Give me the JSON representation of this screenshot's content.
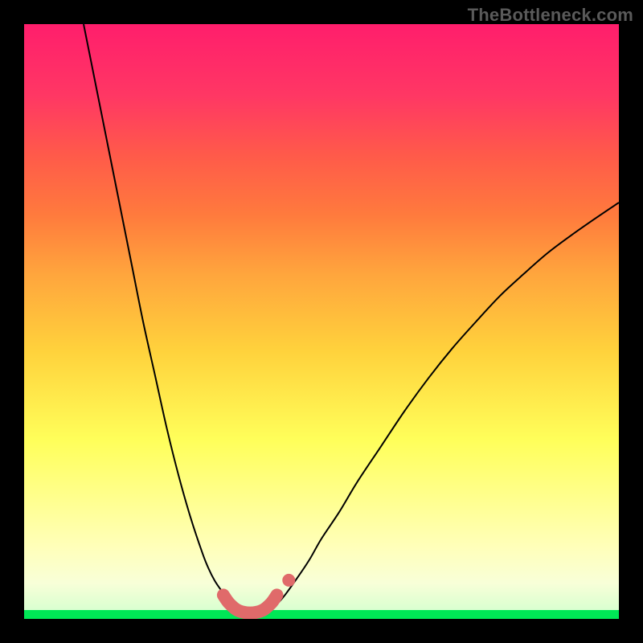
{
  "watermark": "TheBottleneck.com",
  "chart_data": {
    "type": "line",
    "title": "",
    "xlabel": "",
    "ylabel": "",
    "xlim": [
      0,
      100
    ],
    "ylim": [
      0,
      100
    ],
    "background_gradient": {
      "direction": "vertical",
      "stops": [
        {
          "pos": 0,
          "color": "#00e756",
          "meaning": "optimal / no bottleneck"
        },
        {
          "pos": 2,
          "color": "#d9ffd0"
        },
        {
          "pos": 6,
          "color": "#f8ffd8"
        },
        {
          "pos": 12,
          "color": "#ffffba"
        },
        {
          "pos": 30,
          "color": "#ffff5a"
        },
        {
          "pos": 45,
          "color": "#ffd23c"
        },
        {
          "pos": 58,
          "color": "#ffa53d"
        },
        {
          "pos": 68,
          "color": "#ff7a3d"
        },
        {
          "pos": 78,
          "color": "#ff5a4a"
        },
        {
          "pos": 88,
          "color": "#ff3764"
        },
        {
          "pos": 100,
          "color": "#ff1e6c",
          "meaning": "severe bottleneck"
        }
      ]
    },
    "series": [
      {
        "name": "left-branch",
        "stroke": "#000000",
        "stroke_width": 2,
        "x": [
          10,
          12,
          14,
          16,
          18,
          20,
          22,
          24,
          26,
          28,
          30,
          31,
          32,
          33,
          34,
          35,
          36
        ],
        "y": [
          100,
          90,
          80,
          70,
          60,
          50,
          41,
          32,
          24,
          17,
          11,
          8.5,
          6.5,
          5,
          3.8,
          2.8,
          2
        ]
      },
      {
        "name": "right-branch",
        "stroke": "#000000",
        "stroke_width": 2,
        "x": [
          42,
          43,
          44,
          46,
          48,
          50,
          53,
          56,
          60,
          64,
          68,
          72,
          76,
          80,
          84,
          88,
          92,
          96,
          100
        ],
        "y": [
          2,
          3,
          4.2,
          7,
          10,
          13.5,
          18,
          23,
          29,
          35,
          40.5,
          45.5,
          50,
          54.3,
          58,
          61.5,
          64.5,
          67.3,
          70
        ]
      },
      {
        "name": "valley-highlight",
        "stroke": "#e06a6a",
        "stroke_width": 16,
        "linecap": "round",
        "x": [
          33.5,
          34.5,
          36,
          38,
          40,
          41.5,
          42.5
        ],
        "y": [
          4.0,
          2.6,
          1.4,
          1.0,
          1.4,
          2.6,
          4.0
        ]
      },
      {
        "name": "valley-dot",
        "type": "scatter",
        "color": "#e06a6a",
        "radius_px": 8,
        "x": [
          44.5
        ],
        "y": [
          6.5
        ]
      }
    ],
    "annotations": []
  }
}
